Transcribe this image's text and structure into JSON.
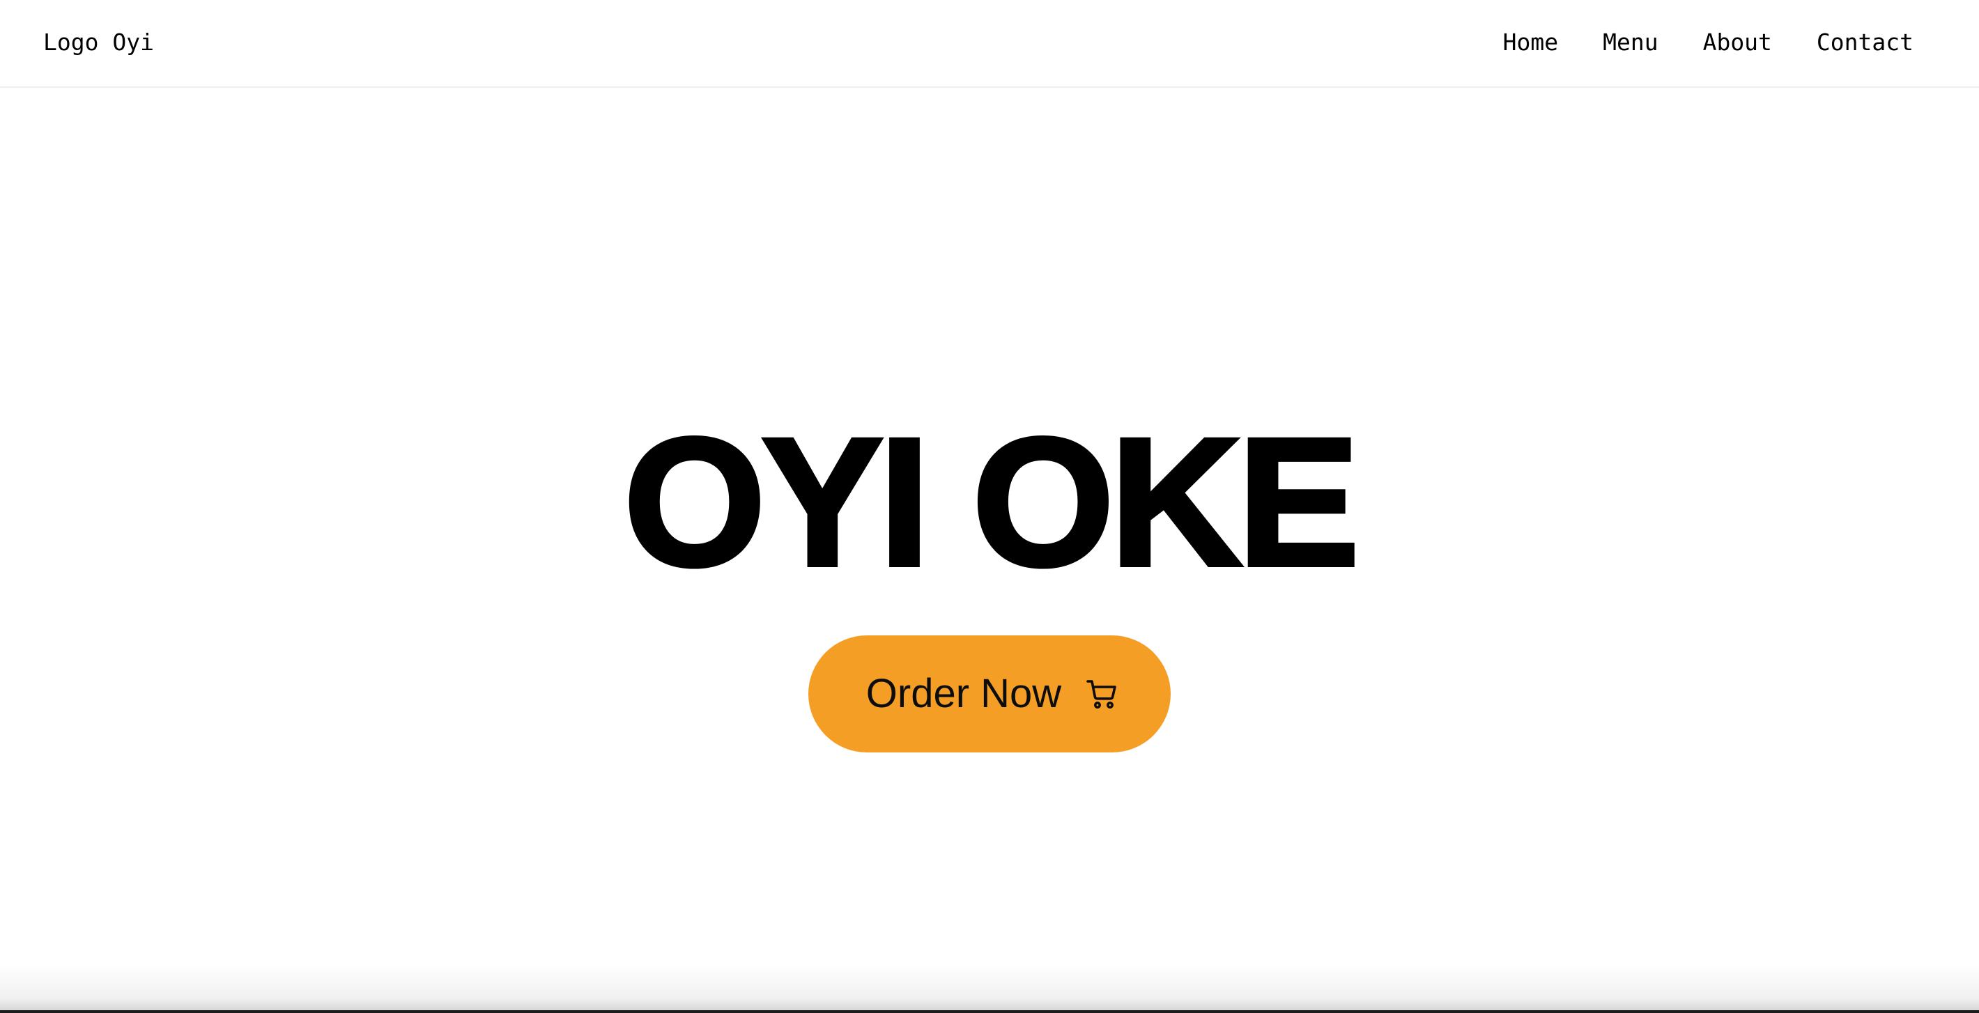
{
  "header": {
    "logo_text": "Logo Oyi",
    "nav": [
      {
        "label": "Home"
      },
      {
        "label": "Menu"
      },
      {
        "label": "About"
      },
      {
        "label": "Contact"
      }
    ]
  },
  "hero": {
    "title": "OYI OKE",
    "cta": {
      "label": "Order Now",
      "icon": "shopping-cart-icon"
    }
  },
  "colors": {
    "accent": "#f59e26",
    "text": "#000000",
    "background": "#ffffff"
  }
}
